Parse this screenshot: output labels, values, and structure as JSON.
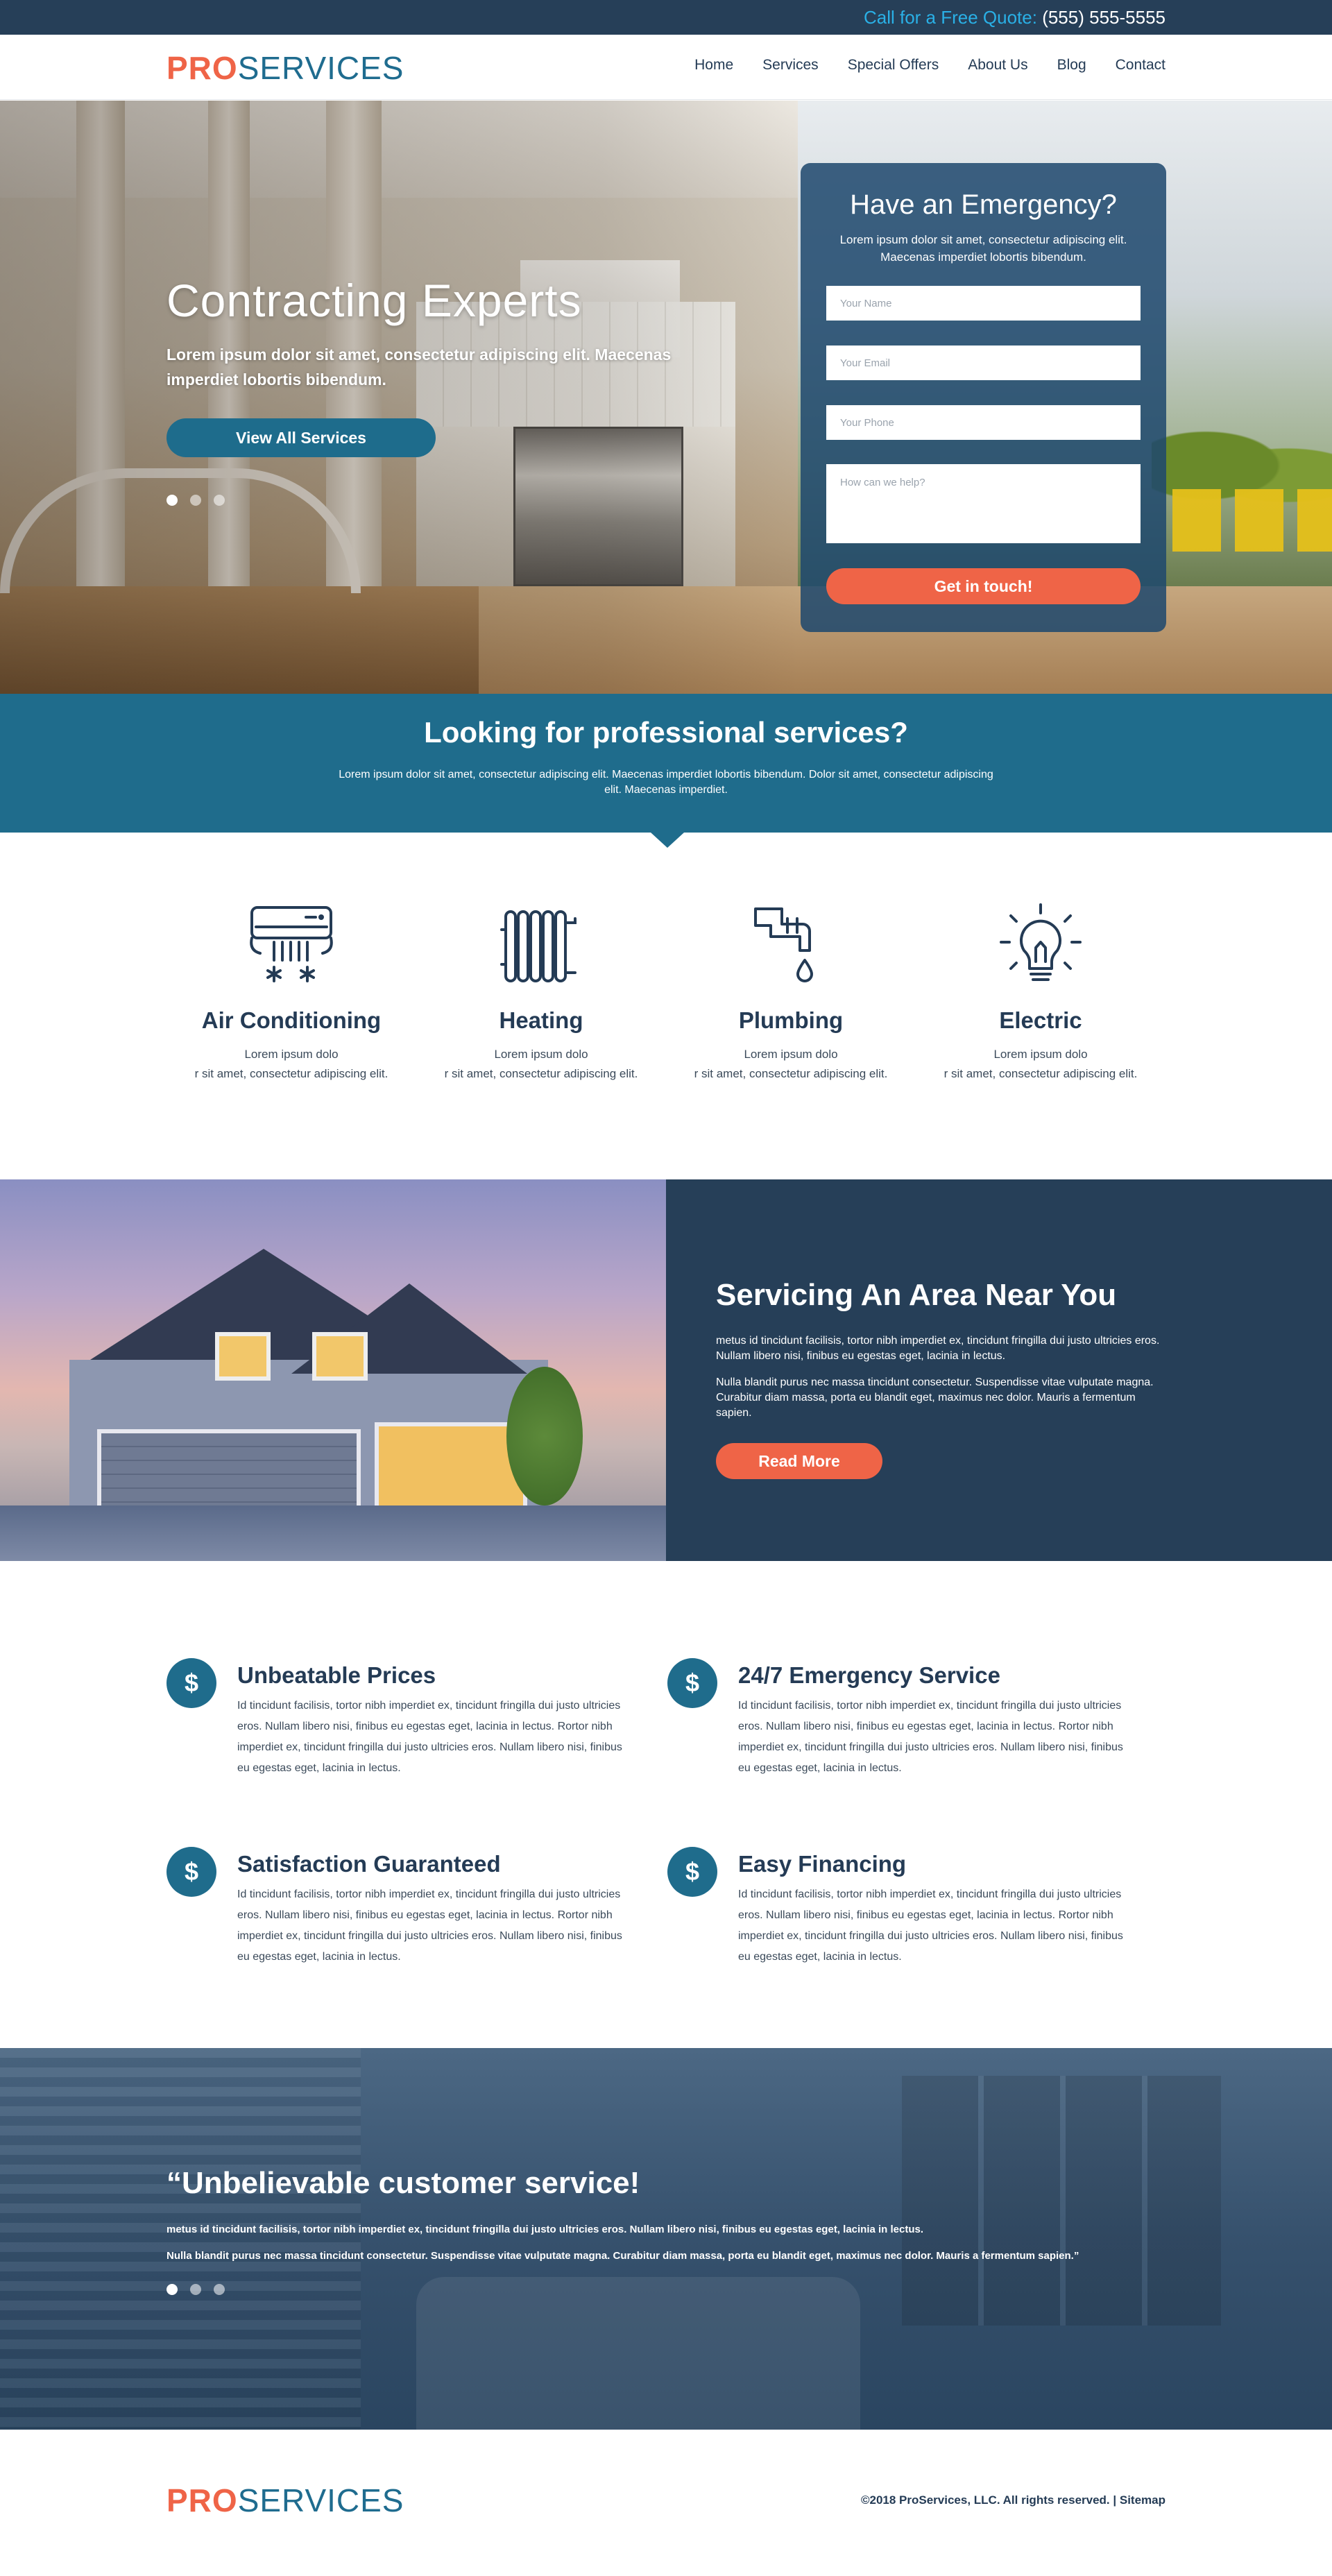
{
  "topbar": {
    "quote_label": "Call for a Free Quote:",
    "phone": "(555) 555-5555"
  },
  "brand": {
    "pro": "PRO",
    "services": "SERVICES"
  },
  "nav": [
    {
      "label": "Home"
    },
    {
      "label": "Services"
    },
    {
      "label": "Special Offers"
    },
    {
      "label": "About Us"
    },
    {
      "label": "Blog"
    },
    {
      "label": "Contact"
    }
  ],
  "hero": {
    "title": "Contracting Experts",
    "subtitle": "Lorem ipsum dolor sit amet, consectetur adipiscing elit. Maecenas imperdiet lobortis bibendum.",
    "button": "View All Services",
    "slides_total": 3,
    "slide_active": 1
  },
  "form": {
    "title": "Have an Emergency?",
    "subtitle": "Lorem ipsum dolor sit amet, consectetur adipiscing elit. Maecenas imperdiet lobortis bibendum.",
    "name_placeholder": "Your Name",
    "email_placeholder": "Your Email",
    "phone_placeholder": "Your Phone",
    "message_placeholder": "How can we help?",
    "button": "Get in touch!"
  },
  "banner": {
    "title": "Looking for professional services?",
    "text": "Lorem ipsum dolor sit amet, consectetur adipiscing elit. Maecenas imperdiet lobortis bibendum. Dolor sit amet, consectetur adipiscing elit. Maecenas imperdiet."
  },
  "services": [
    {
      "icon": "air-conditioner-icon",
      "title": "Air Conditioning",
      "line1": "Lorem ipsum dolo",
      "line2": "r sit amet, consectetur adipiscing elit."
    },
    {
      "icon": "radiator-icon",
      "title": "Heating",
      "line1": "Lorem ipsum dolo",
      "line2": "r sit amet, consectetur adipiscing elit."
    },
    {
      "icon": "faucet-icon",
      "title": "Plumbing",
      "line1": "Lorem ipsum dolo",
      "line2": "r sit amet, consectetur adipiscing elit."
    },
    {
      "icon": "light-bulb-icon",
      "title": "Electric",
      "line1": "Lorem ipsum dolo",
      "line2": "r sit amet, consectetur adipiscing elit."
    }
  ],
  "area": {
    "title": "Servicing An Area Near You",
    "p1": "metus id tincidunt facilisis, tortor nibh imperdiet ex, tincidunt fringilla dui justo ultricies eros. Nullam libero nisi, finibus eu egestas eget, lacinia in lectus.",
    "p2": "Nulla blandit purus nec massa tincidunt consectetur. Suspendisse vitae vulputate magna. Curabitur diam massa, porta eu blandit eget, maximus nec dolor. Mauris a fermentum sapien.",
    "button": "Read More"
  },
  "features": [
    {
      "icon": "$",
      "title": "Unbeatable Prices",
      "body": "Id tincidunt facilisis, tortor nibh imperdiet ex, tincidunt fringilla dui justo ultricies eros. Nullam libero nisi, finibus eu egestas eget, lacinia in lectus. Rortor nibh imperdiet ex, tincidunt fringilla dui justo ultricies eros. Nullam libero nisi, finibus eu egestas eget, lacinia in lectus."
    },
    {
      "icon": "$",
      "title": "24/7 Emergency Service",
      "body": "Id tincidunt facilisis, tortor nibh imperdiet ex, tincidunt fringilla dui justo ultricies eros. Nullam libero nisi, finibus eu egestas eget, lacinia in lectus. Rortor nibh imperdiet ex, tincidunt fringilla dui justo ultricies eros. Nullam libero nisi, finibus eu egestas eget, lacinia in lectus."
    },
    {
      "icon": "$",
      "title": "Satisfaction Guaranteed",
      "body": "Id tincidunt facilisis, tortor nibh imperdiet ex, tincidunt fringilla dui justo ultricies eros. Nullam libero nisi, finibus eu egestas eget, lacinia in lectus. Rortor nibh imperdiet ex, tincidunt fringilla dui justo ultricies eros. Nullam libero nisi, finibus eu egestas eget, lacinia in lectus."
    },
    {
      "icon": "$",
      "title": "Easy Financing",
      "body": "Id tincidunt facilisis, tortor nibh imperdiet ex, tincidunt fringilla dui justo ultricies eros. Nullam libero nisi, finibus eu egestas eget, lacinia in lectus. Rortor nibh imperdiet ex, tincidunt fringilla dui justo ultricies eros. Nullam libero nisi, finibus eu egestas eget, lacinia in lectus."
    }
  ],
  "testimonial": {
    "quote": "“Unbelievable customer service!",
    "p1": "metus id tincidunt facilisis, tortor nibh imperdiet ex, tincidunt fringilla dui justo ultricies eros. Nullam libero nisi, finibus eu egestas eget, lacinia in lectus.",
    "p2": "Nulla blandit purus nec massa tincidunt consectetur. Suspendisse vitae vulputate magna. Curabitur diam massa, porta eu blandit eget, maximus nec dolor. Mauris a fermentum sapien.”",
    "slides_total": 3,
    "slide_active": 1
  },
  "footer": {
    "copyright": "©2018 ProServices, LLC. All rights reserved. | Sitemap"
  },
  "colors": {
    "navy": "#263f58",
    "teal": "#1f6c8c",
    "orange": "#ef6447",
    "cyan": "#2ab0e6"
  }
}
